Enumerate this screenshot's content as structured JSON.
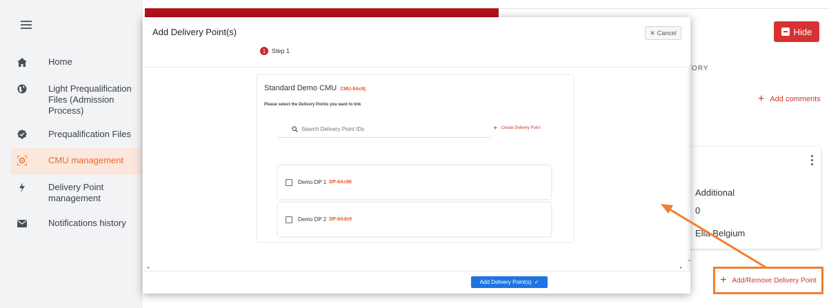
{
  "sidebar": {
    "menu_icon": "hamburger-icon",
    "items": [
      {
        "label": "Home",
        "icon": "home-icon"
      },
      {
        "label": "Light Prequalification Files (Admission Process)",
        "icon": "globe-icon"
      },
      {
        "label": "Prequalification Files",
        "icon": "badge-check-icon"
      },
      {
        "label": "CMU management",
        "icon": "cmu-icon",
        "active": true
      },
      {
        "label": "Delivery Point management",
        "icon": "lightning-icon"
      },
      {
        "label": "Notifications history",
        "icon": "envelope-icon"
      }
    ]
  },
  "background": {
    "hide_label": "Hide",
    "history_label": "TORY",
    "add_comments_label": "Add comments",
    "card": {
      "line1": "Additional",
      "line2": "0",
      "line3": "Elia Belgium"
    },
    "add_remove_label": "Add/Remove Delivery Point"
  },
  "modal": {
    "title": "Add Delivery Point(s)",
    "cancel_label": "Cancel",
    "step_number": "1",
    "step_label": "Step 1",
    "cmu_name": "Standard Demo CMU",
    "cmu_code": "CMU-9Ac8j",
    "instruction": "Please select the Delivery Points you want to link",
    "search_placeholder": "Search Delivery Point IDs",
    "create_label": "Create Delivery Point",
    "delivery_points": [
      {
        "name": "Demo DP 1",
        "code": "DP-9Ac86",
        "checked": false
      },
      {
        "name": "Demo DP 2",
        "code": "DP-9Adz9",
        "checked": false
      }
    ],
    "submit_label": "Add Delivery Point(s)"
  },
  "colors": {
    "accent_orange": "#ef7f31",
    "brand_red": "#b5121b",
    "primary_blue": "#1e74e0",
    "code_orange": "#e8562a"
  }
}
